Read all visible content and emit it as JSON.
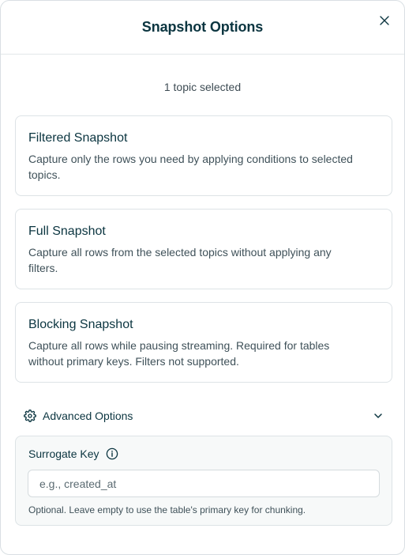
{
  "dialog": {
    "title": "Snapshot Options"
  },
  "selection": {
    "count_text": "1 topic selected"
  },
  "options": [
    {
      "title": "Filtered Snapshot",
      "description_lines": [
        "Capture only the rows you need by applying conditions to selected",
        "topics."
      ]
    },
    {
      "title": "Full Snapshot",
      "description_lines": [
        "Capture all rows from the selected topics without applying any",
        "filters."
      ]
    },
    {
      "title": "Blocking Snapshot",
      "description_lines": [
        "Capture all rows while pausing streaming. Required for tables",
        "without primary keys. Filters not supported."
      ]
    }
  ],
  "advanced": {
    "label": "Advanced Options",
    "expanded": true,
    "surrogate_key": {
      "label": "Surrogate Key",
      "value": "",
      "placeholder": "e.g., created_at",
      "help": "Optional. Leave empty to use the table's primary key for chunking."
    }
  },
  "icons": {
    "close": "close-icon",
    "advanced": "gear-icon",
    "toggle": "chevron-down-icon",
    "info": "info-icon"
  },
  "colors": {
    "text_primary": "#0b3540",
    "text_secondary": "#3f5159",
    "border": "#dde3e6",
    "panel_bg": "#f7f9f9"
  }
}
